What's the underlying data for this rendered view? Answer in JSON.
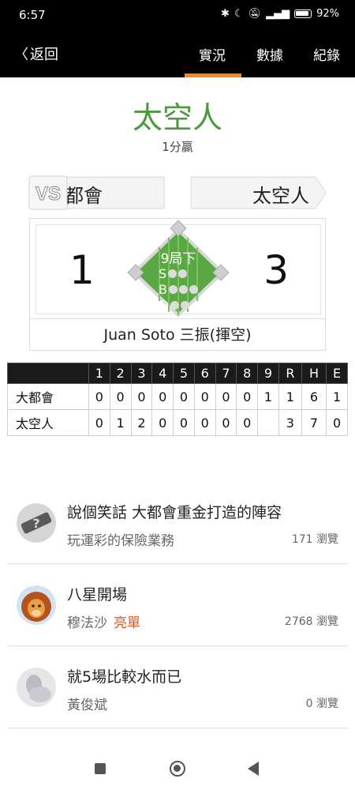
{
  "status_bar": {
    "time": "6:57",
    "battery": "92%",
    "icons": [
      "bluetooth-icon",
      "moon-icon",
      "mute-icon",
      "volte-icon",
      "signal-icon",
      "battery-icon"
    ]
  },
  "header": {
    "back_label": "返回",
    "tabs": [
      {
        "label": "實況",
        "active": true
      },
      {
        "label": "數據",
        "active": false
      },
      {
        "label": "紀錄",
        "active": false
      }
    ],
    "accent_color": "#f08a1c"
  },
  "game": {
    "winner": "太空人",
    "winner_color": "#4a9a3c",
    "result": "1分贏",
    "away_team": "大都會",
    "home_team": "太空人",
    "vs_label": "VS",
    "away_score": "1",
    "home_score": "3",
    "inning": "9局下",
    "count_labels": {
      "s": "S",
      "b": "B",
      "o": "O"
    },
    "last_play": "Juan Soto 三振(揮空)"
  },
  "linescore": {
    "headers": [
      "",
      "1",
      "2",
      "3",
      "4",
      "5",
      "6",
      "7",
      "8",
      "9",
      "R",
      "H",
      "E"
    ],
    "rows": [
      {
        "team": "大都會",
        "cells": [
          "0",
          "0",
          "0",
          "0",
          "0",
          "0",
          "0",
          "0",
          "1",
          "1",
          "6",
          "1"
        ]
      },
      {
        "team": "太空人",
        "cells": [
          "0",
          "1",
          "2",
          "0",
          "0",
          "0",
          "0",
          "0",
          "",
          "3",
          "7",
          "0"
        ]
      }
    ]
  },
  "feed": [
    {
      "title": "說個笑話 大都會重金打造的陣容",
      "author": "玩運彩的保險業務",
      "tag": "",
      "views": "171 瀏覽",
      "avatar": "placeholder-avatar"
    },
    {
      "title": "八星開場",
      "author": "穆法沙",
      "tag": "亮單",
      "views": "2768 瀏覽",
      "avatar": "lion-avatar"
    },
    {
      "title": "就5場比較水而已",
      "author": "黃俊斌",
      "tag": "",
      "views": "0 瀏覽",
      "avatar": "photo-avatar"
    }
  ],
  "colors": {
    "field_green": "#5aa843",
    "tag_orange": "#e0541f"
  }
}
